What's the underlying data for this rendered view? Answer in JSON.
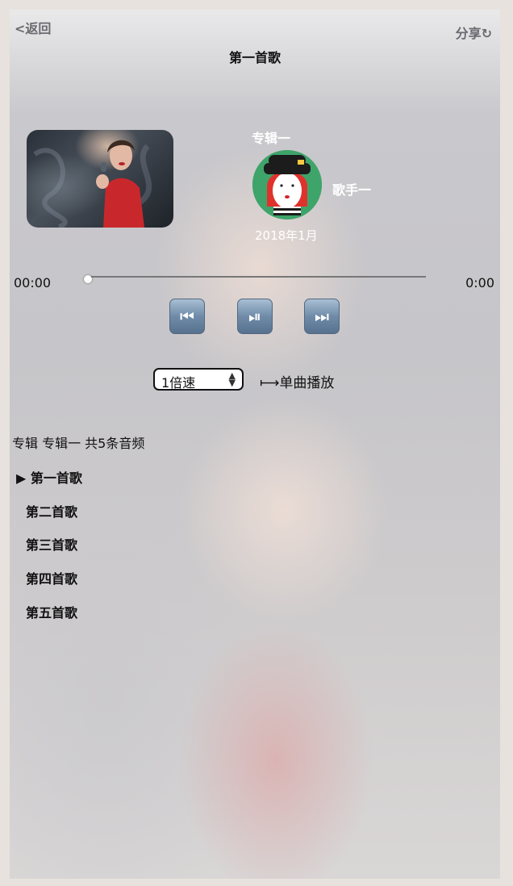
{
  "header": {
    "back_label": "<返回",
    "share_label": "分享",
    "share_icon": "refresh-icon",
    "title": "第一首歌"
  },
  "album": {
    "name": "专辑一",
    "artist": "歌手一",
    "date": "2018年1月"
  },
  "player": {
    "current_time": "00:00",
    "duration": "0:00",
    "progress": 0,
    "controls": [
      "previous-icon",
      "play-pause-icon",
      "next-icon"
    ],
    "speed": "1倍速",
    "mode_label": "⟼单曲播放"
  },
  "playlist": {
    "summary": "专辑 专辑一 共5条音频",
    "current_marker": "▶",
    "songs": [
      "第一首歌",
      "第二首歌",
      "第三首歌",
      "第四首歌",
      "第五首歌"
    ]
  }
}
